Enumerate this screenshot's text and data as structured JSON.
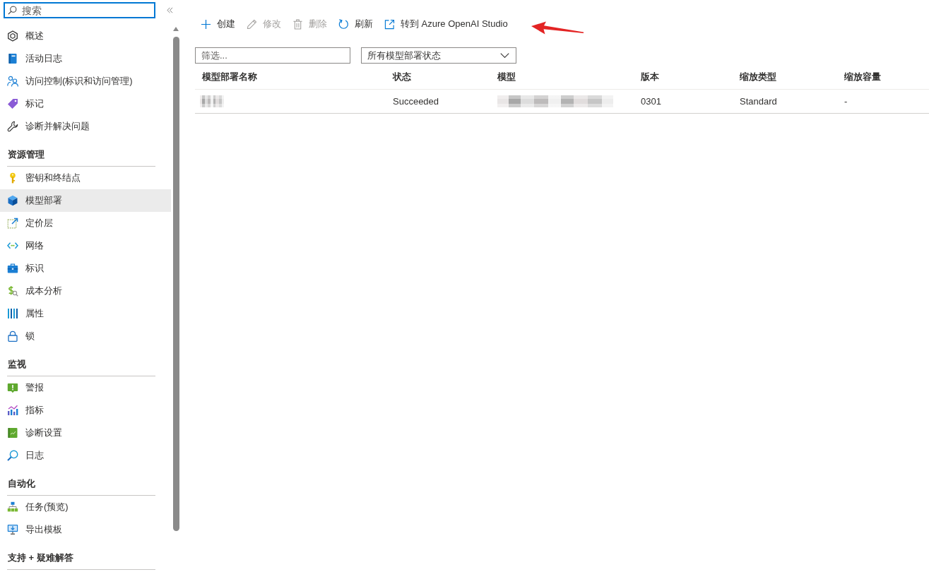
{
  "sidebar": {
    "search": {
      "placeholder": "搜索"
    },
    "sections": [
      {
        "items": [
          {
            "label": "概述",
            "selected": false
          },
          {
            "label": "活动日志",
            "selected": false
          },
          {
            "label": "访问控制(标识和访问管理)",
            "selected": false
          },
          {
            "label": "标记",
            "selected": false
          },
          {
            "label": "诊断并解决问题",
            "selected": false
          }
        ]
      },
      {
        "title": "资源管理",
        "items": [
          {
            "label": "密钥和终结点",
            "selected": false
          },
          {
            "label": "模型部署",
            "selected": true
          },
          {
            "label": "定价层",
            "selected": false
          },
          {
            "label": "网络",
            "selected": false
          },
          {
            "label": "标识",
            "selected": false
          },
          {
            "label": "成本分析",
            "selected": false
          },
          {
            "label": "属性",
            "selected": false
          },
          {
            "label": "锁",
            "selected": false
          }
        ]
      },
      {
        "title": "监视",
        "items": [
          {
            "label": "警报",
            "selected": false
          },
          {
            "label": "指标",
            "selected": false
          },
          {
            "label": "诊断设置",
            "selected": false
          },
          {
            "label": "日志",
            "selected": false
          }
        ]
      },
      {
        "title": "自动化",
        "items": [
          {
            "label": "任务(预览)",
            "selected": false
          },
          {
            "label": "导出模板",
            "selected": false
          }
        ]
      },
      {
        "title": "支持 + 疑难解答"
      }
    ]
  },
  "toolbar": {
    "buttons": [
      {
        "label": "创建",
        "disabled": false
      },
      {
        "label": "修改",
        "disabled": true
      },
      {
        "label": "删除",
        "disabled": true
      },
      {
        "label": "刷新",
        "disabled": false
      },
      {
        "label": "转到 Azure OpenAI Studio",
        "disabled": false
      }
    ]
  },
  "filters": {
    "filter": {
      "placeholder": "筛选..."
    },
    "status_dropdown": {
      "value": "所有模型部署状态"
    }
  },
  "table": {
    "columns": [
      "模型部署名称",
      "状态",
      "模型",
      "版本",
      "缩放类型",
      "缩放容量"
    ],
    "rows": [
      {
        "cells": [
          {
            "kind": "redacted"
          },
          {
            "kind": "text",
            "text": "Succeeded"
          },
          {
            "kind": "redacted"
          },
          {
            "kind": "text",
            "text": "0301"
          },
          {
            "kind": "text",
            "text": "Standard"
          },
          {
            "kind": "text",
            "text": "-"
          }
        ]
      }
    ]
  },
  "annotations": [
    {
      "kind": "arrow"
    }
  ]
}
